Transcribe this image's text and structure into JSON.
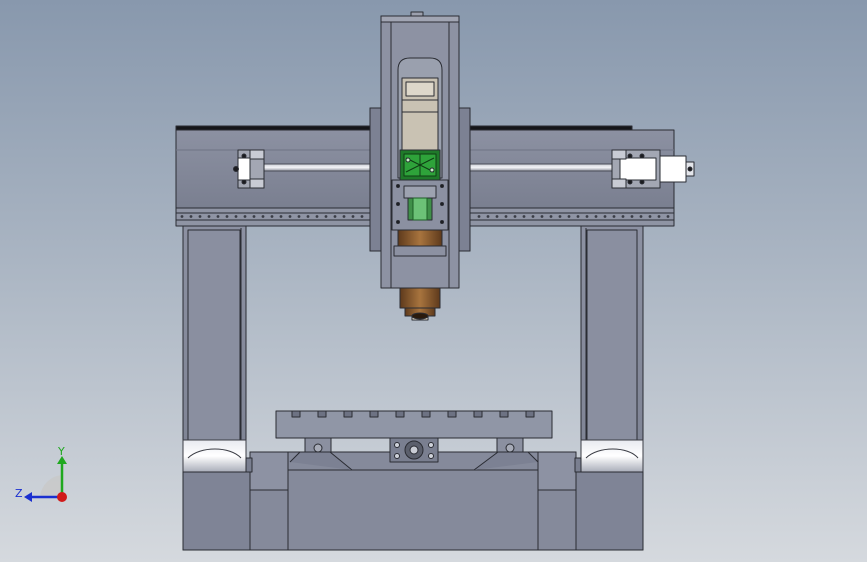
{
  "triad": {
    "y_label": "Y",
    "z_label": "Z",
    "colors": {
      "y": "#1fa81f",
      "z": "#1a2fd0",
      "x": "#d11a1a"
    }
  },
  "palette": {
    "steel": "#7f8496",
    "steel_light": "#9a9fae",
    "steel_dark": "#6e7384",
    "line": "#2a2c33",
    "motor_green": "#1f7a2a",
    "spindle_bronze": "#8a5a2c"
  }
}
